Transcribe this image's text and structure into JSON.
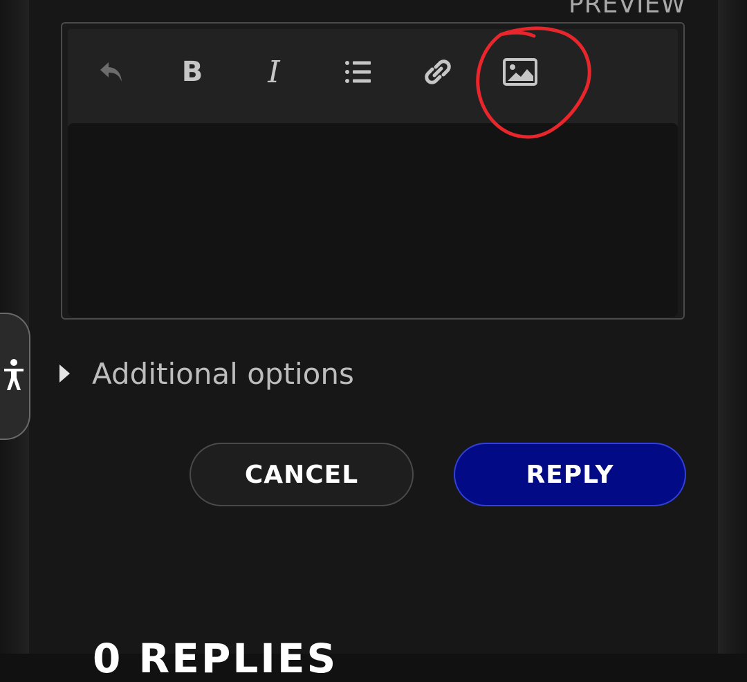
{
  "header": {
    "preview_label": "PREVIEW"
  },
  "toolbar": {
    "tools": [
      {
        "icon": "undo-icon"
      },
      {
        "icon": "bold-icon",
        "glyph": "B"
      },
      {
        "icon": "italic-icon",
        "glyph": "I"
      },
      {
        "icon": "bulleted-list-icon"
      },
      {
        "icon": "link-icon"
      },
      {
        "icon": "image-icon"
      }
    ]
  },
  "editor": {
    "value": ""
  },
  "options": {
    "label": "Additional options"
  },
  "actions": {
    "cancel_label": "CANCEL",
    "reply_label": "REPLY"
  },
  "replies": {
    "heading": "0 REPLIES"
  },
  "colors": {
    "background": "#171717",
    "reply_button": "#020a86",
    "annotation": "#e8262b"
  }
}
